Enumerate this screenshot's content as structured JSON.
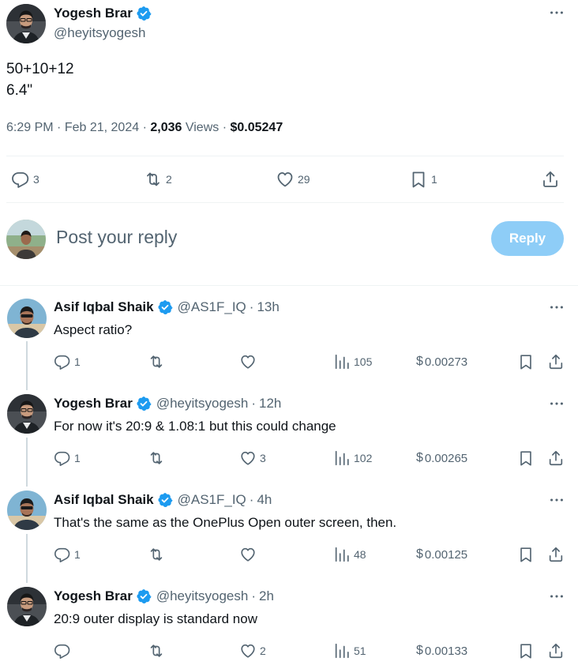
{
  "main_tweet": {
    "author_name": "Yogesh Brar",
    "author_handle": "@heyitsyogesh",
    "text_lines": [
      "50+10+12",
      "6.4\""
    ],
    "time": "6:29 PM",
    "date": "Feb 21, 2024",
    "views_count": "2,036",
    "views_label": "Views",
    "price": "$0.05247",
    "reply_count": "3",
    "retweet_count": "2",
    "like_count": "29",
    "bookmark_count": "1"
  },
  "composer": {
    "placeholder": "Post your reply",
    "button_label": "Reply"
  },
  "replies": [
    {
      "author_name": "Asif Iqbal Shaik",
      "author_handle": "@AS1F_IQ",
      "age": "13h",
      "text": "Aspect ratio?",
      "reply_count": "1",
      "retweet_count": "",
      "like_count": "",
      "views": "105",
      "price_symbol": "$",
      "price": "0.00273"
    },
    {
      "author_name": "Yogesh Brar",
      "author_handle": "@heyitsyogesh",
      "age": "12h",
      "text": "For now it's 20:9 & 1.08:1 but this could change",
      "reply_count": "1",
      "retweet_count": "",
      "like_count": "3",
      "views": "102",
      "price_symbol": "$",
      "price": "0.00265"
    },
    {
      "author_name": "Asif Iqbal Shaik",
      "author_handle": "@AS1F_IQ",
      "age": "4h",
      "text": "That's the same as the OnePlus Open outer screen, then.",
      "reply_count": "1",
      "retweet_count": "",
      "like_count": "",
      "views": "48",
      "price_symbol": "$",
      "price": "0.00125"
    },
    {
      "author_name": "Yogesh Brar",
      "author_handle": "@heyitsyogesh",
      "age": "2h",
      "text": "20:9 outer display is standard now",
      "reply_count": "",
      "retweet_count": "",
      "like_count": "2",
      "views": "51",
      "price_symbol": "$",
      "price": "0.00133"
    }
  ],
  "colors": {
    "accent": "#1d9bf0",
    "reply_button": "#8ecdf7",
    "secondary_text": "#536471",
    "divider": "#eff3f4"
  }
}
